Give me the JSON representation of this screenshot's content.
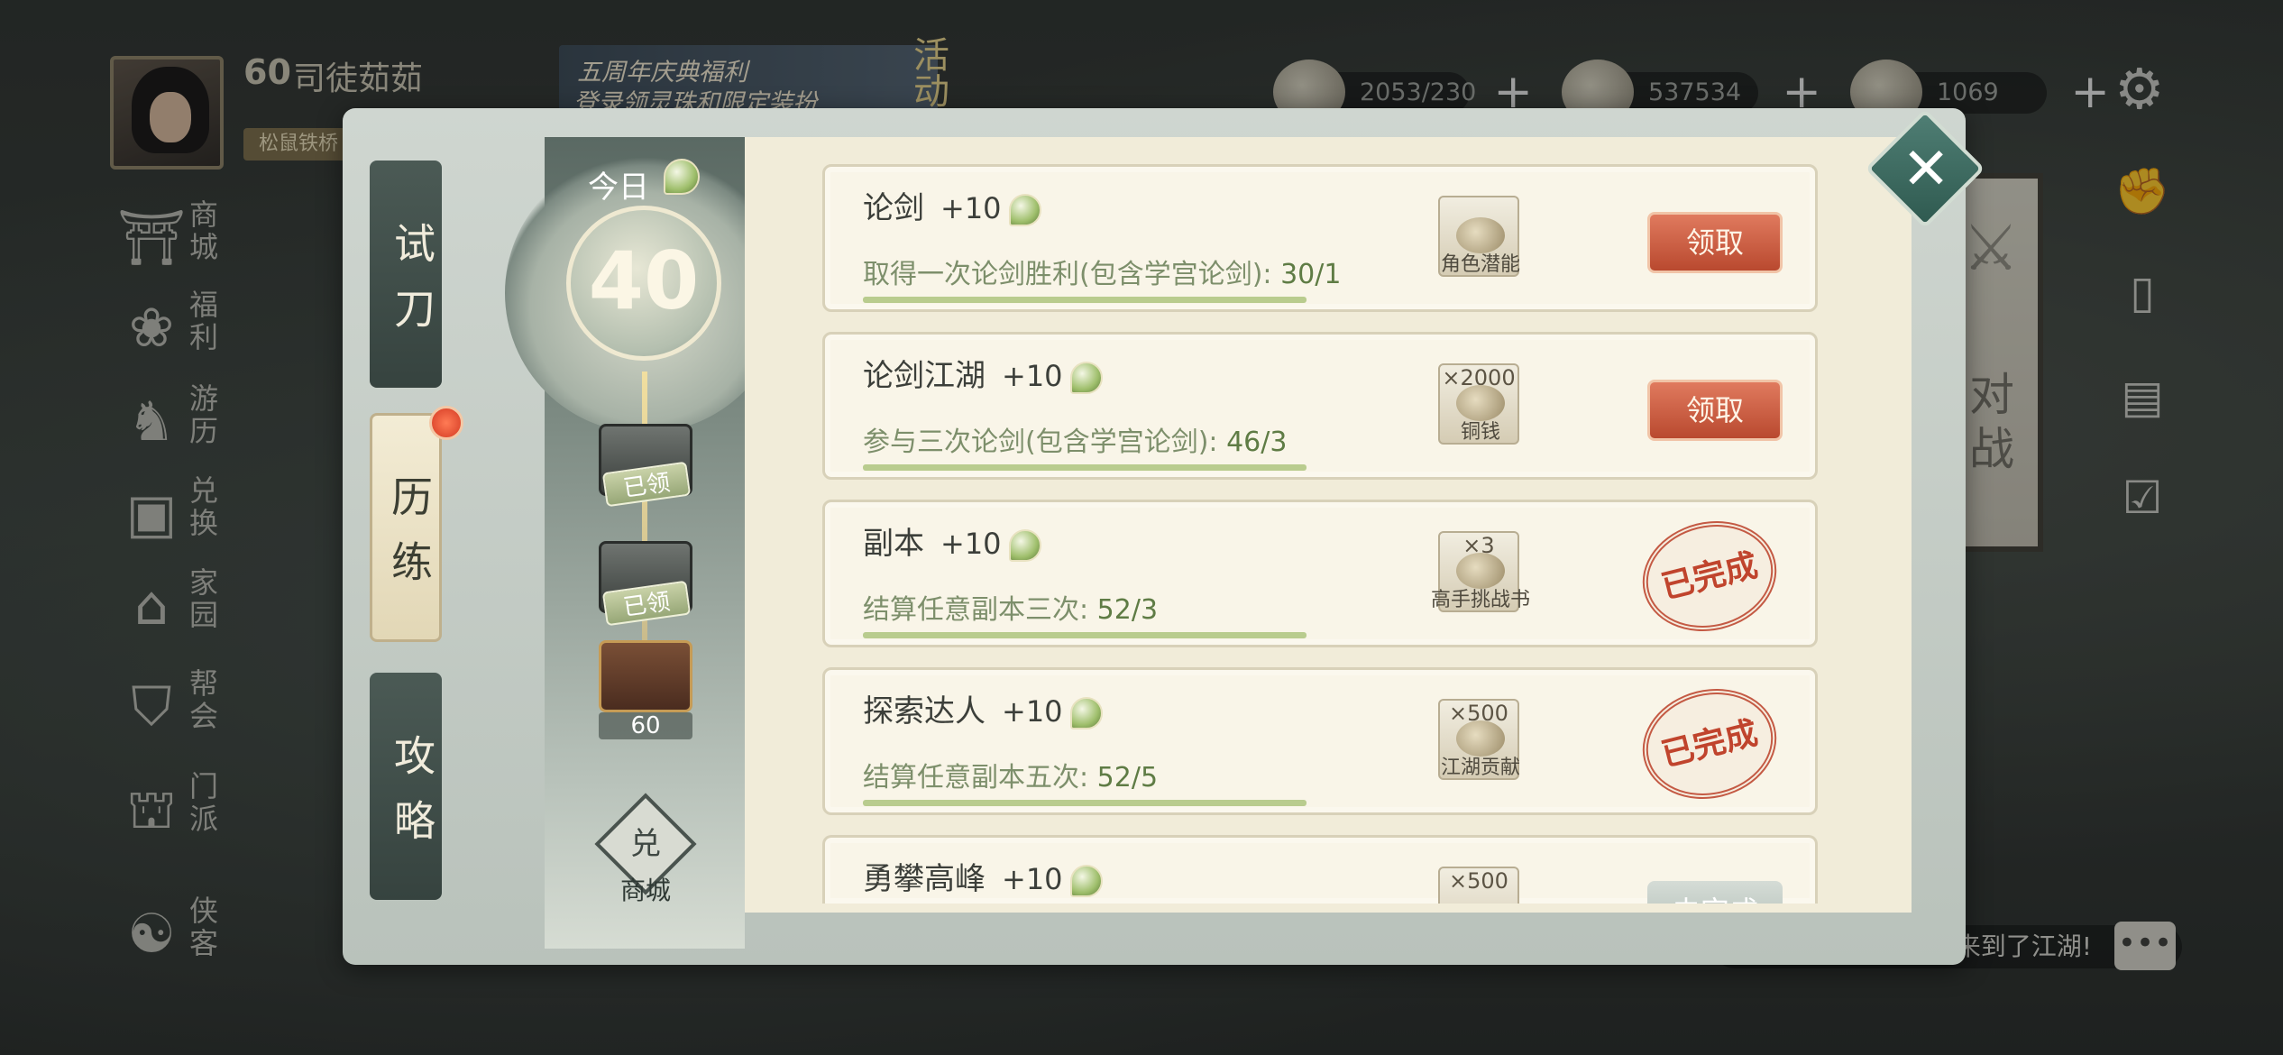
{
  "player": {
    "level": "60",
    "name": "司徒茹茹",
    "title": "松鼠铁桥"
  },
  "event_banner": {
    "line1": "五周年庆典福利",
    "line2": "登录领灵珠和限定装扮",
    "tag": "活动"
  },
  "resources": [
    {
      "icon": "steamed-bun-icon",
      "value": "2053/230"
    },
    {
      "icon": "copper-coins-icon",
      "value": "537534"
    },
    {
      "icon": "gold-ingot-icon",
      "value": "1069"
    }
  ],
  "left_nav": [
    {
      "icon": "shop-icon",
      "label": "商城"
    },
    {
      "icon": "lotus-icon",
      "label": "福利"
    },
    {
      "icon": "horse-icon",
      "label": "游历"
    },
    {
      "icon": "exchange-icon",
      "label": "兑换"
    },
    {
      "icon": "home-icon",
      "label": "家园"
    },
    {
      "icon": "guild-icon",
      "label": "帮会"
    },
    {
      "icon": "sect-icon",
      "label": "门派"
    },
    {
      "icon": "hero-icon",
      "label": "侠客"
    }
  ],
  "right_nav": [
    "fist-icon",
    "book-icon",
    "scroll-icon",
    "checklist-icon"
  ],
  "pvp_banner": {
    "label": "对战"
  },
  "chat": {
    "text": "来到了江湖!"
  },
  "tabs": [
    {
      "label": "试刀",
      "active": false
    },
    {
      "label": "历练",
      "active": true
    },
    {
      "label": "攻略",
      "active": false
    }
  ],
  "today": {
    "label": "今日",
    "value": "40"
  },
  "milestones": [
    {
      "status": "已领"
    },
    {
      "status": "已领"
    },
    {
      "value": "60"
    }
  ],
  "shop": {
    "icon_text": "兑",
    "label": "商城"
  },
  "tasks": [
    {
      "title": "论剑",
      "points": "+10",
      "desc": "取得一次论剑胜利(包含学宫论剑): ",
      "progress": "30/1",
      "reward_name": "角色潜能",
      "reward_qty": "",
      "action": "领取",
      "state": "claimable"
    },
    {
      "title": "论剑江湖",
      "points": "+10",
      "desc": "参与三次论剑(包含学宫论剑): ",
      "progress": "46/3",
      "reward_name": "铜钱",
      "reward_qty": "×2000",
      "action": "领取",
      "state": "claimable"
    },
    {
      "title": "副本",
      "points": "+10",
      "desc": "结算任意副本三次: ",
      "progress": "52/3",
      "reward_name": "高手挑战书",
      "reward_qty": "×3",
      "action": "已完成",
      "state": "done"
    },
    {
      "title": "探索达人",
      "points": "+10",
      "desc": "结算任意副本五次: ",
      "progress": "52/5",
      "reward_name": "江湖贡献",
      "reward_qty": "×500",
      "action": "已完成",
      "state": "done"
    },
    {
      "title": "勇攀高峰",
      "points": "+10",
      "desc": "",
      "progress": "",
      "reward_name": "",
      "reward_qty": "×500",
      "action": "未完成",
      "state": "pending"
    }
  ],
  "close": {
    "glyph": "✕"
  }
}
